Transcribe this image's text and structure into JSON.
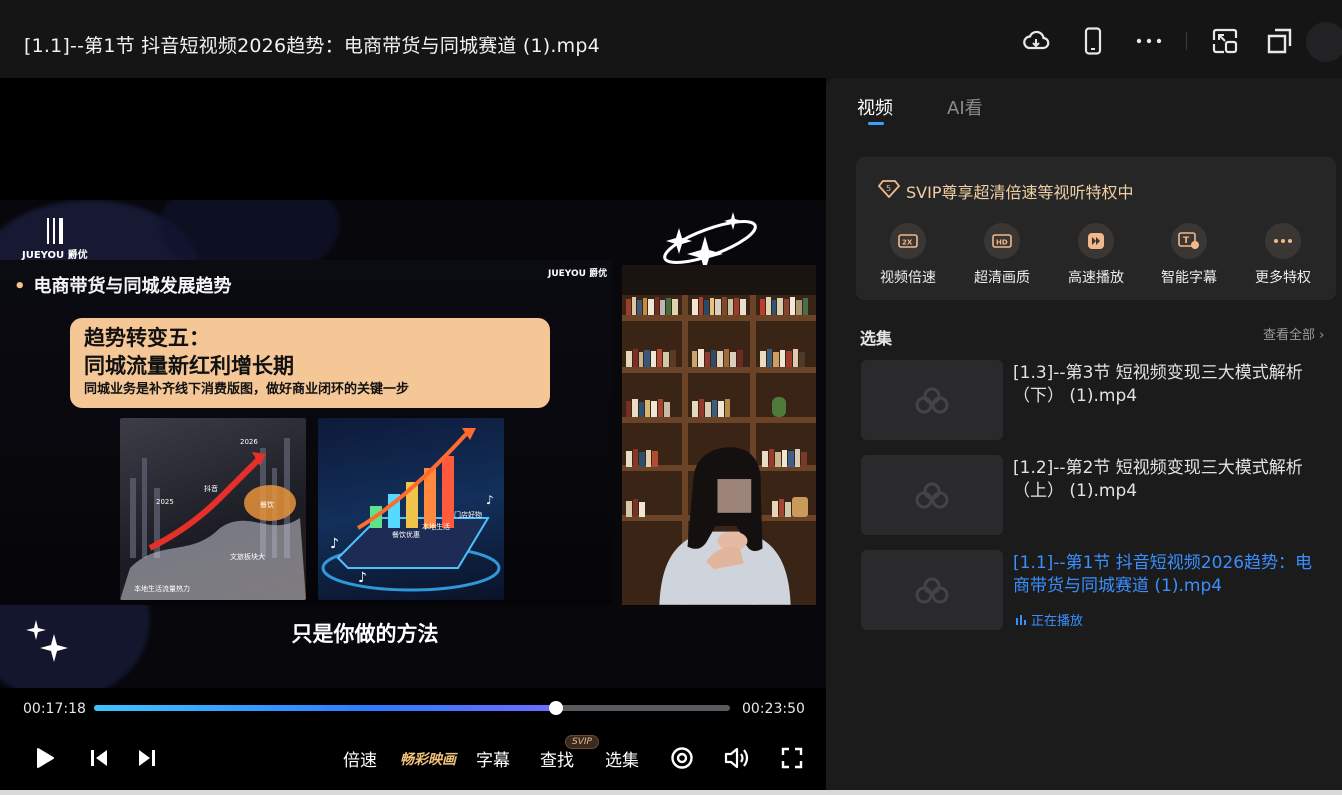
{
  "window": {
    "title": "[1.1]--第1节 抖音短视频2026趋势：电商带货与同城赛道 (1).mp4",
    "icons": [
      "cloud-download-icon",
      "phone-icon",
      "more-icon",
      "pip-icon",
      "fullscreen-window-icon"
    ]
  },
  "video": {
    "slide": {
      "logo_text": "JUEYOU 爵优",
      "heading": "电商带货与同城发展趋势",
      "logo2": "JUEYOU 爵优",
      "card_line1": "趋势转变五：",
      "card_line2": "同城流量新红利增长期",
      "card_line3": "同城业务是补齐线下消费版图，做好商业闭环的关键一步",
      "img1_labels": [
        "2026",
        "2025",
        "抖音",
        "餐饮",
        "文旅板块大",
        "本地生活流量热力"
      ],
      "img2_labels": [
        "餐饮优惠",
        "本地生活",
        "门店好物"
      ]
    },
    "subtitle": "只是你做的方法"
  },
  "controls": {
    "current_time": "00:17:18",
    "total_time": "00:23:50",
    "progress": 0.726,
    "speed_label": "倍速",
    "jingcai_label": "畅彩映画",
    "subtitle_label": "字幕",
    "find_label": "查找",
    "svip_badge": "SVIP",
    "episodes_label": "选集"
  },
  "panel": {
    "tabs": [
      {
        "label": "视频",
        "active": true
      },
      {
        "label": "AI看",
        "active": false
      }
    ],
    "svip_title": "SVIP尊享超清倍速等视听特权中",
    "perks": [
      {
        "label": "视频倍速",
        "icon": "speed-2x-icon",
        "glyph": "2X"
      },
      {
        "label": "超清画质",
        "icon": "hd-icon",
        "glyph": "HD"
      },
      {
        "label": "高速播放",
        "icon": "fast-play-icon",
        "glyph": "▶"
      },
      {
        "label": "智能字幕",
        "icon": "smart-subtitle-icon",
        "glyph": "T"
      },
      {
        "label": "更多特权",
        "icon": "more-perks-icon",
        "glyph": "···"
      }
    ],
    "episodes_title": "选集",
    "see_all": "查看全部",
    "episodes": [
      {
        "title": "[1.3]--第3节 短视频变现三大模式解析（下） (1).mp4",
        "playing": false
      },
      {
        "title": "[1.2]--第2节 短视频变现三大模式解析（上） (1).mp4",
        "playing": false
      },
      {
        "title": "[1.1]--第1节 抖音短视频2026趋势：电商带货与同城赛道 (1).mp4",
        "playing": true,
        "status": "正在播放"
      }
    ]
  },
  "colors": {
    "accent": "#3a8fff",
    "svip_gold": "#f1cfa6",
    "slide_card": "#f5c696"
  }
}
